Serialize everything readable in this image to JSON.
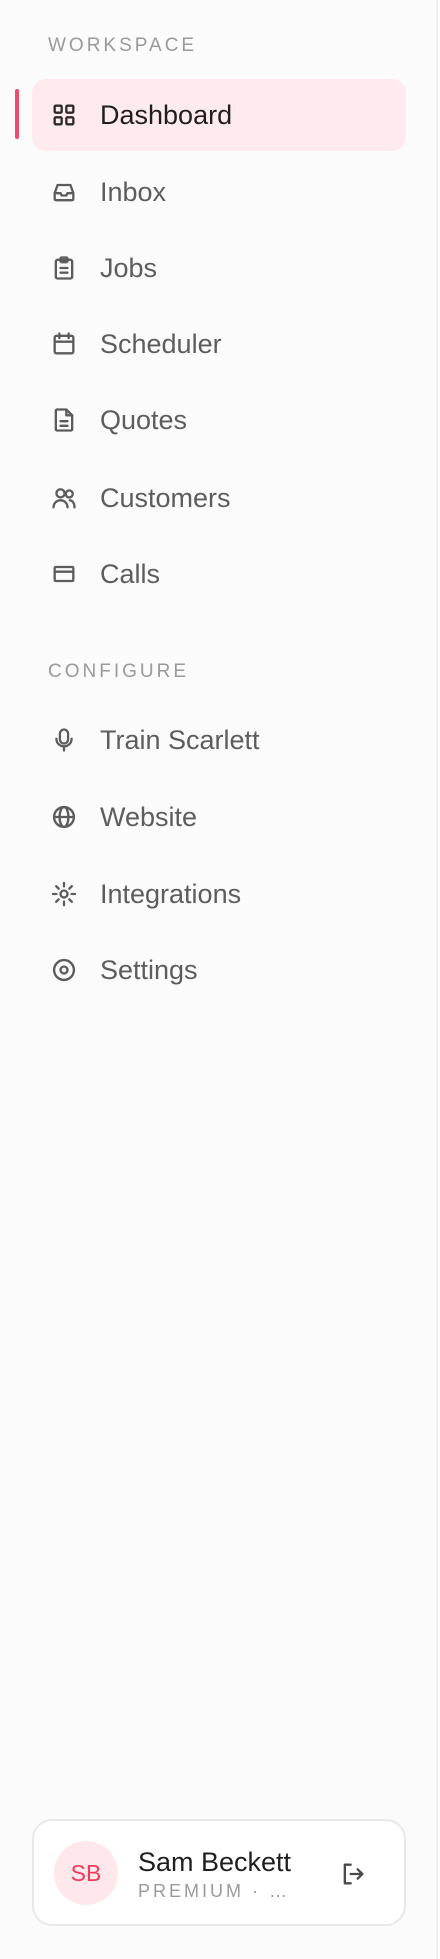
{
  "colors": {
    "accent": "#ec4d6a",
    "active_bg": "#ffeaed",
    "text": "#5d5d5d",
    "section_label": "#9a9a9a"
  },
  "sidebar": {
    "workspace_label": "WORKSPACE",
    "configure_label": "CONFIGURE",
    "workspace_items": [
      {
        "label": "Dashboard",
        "icon": "grid-icon",
        "active": true
      },
      {
        "label": "Inbox",
        "icon": "inbox-icon"
      },
      {
        "label": "Jobs",
        "icon": "clipboard-icon"
      },
      {
        "label": "Scheduler",
        "icon": "calendar-icon"
      },
      {
        "label": "Quotes",
        "icon": "document-icon"
      },
      {
        "label": "Customers",
        "icon": "users-icon"
      },
      {
        "label": "Calls",
        "icon": "card-icon"
      }
    ],
    "configure_items": [
      {
        "label": "Train Scarlett",
        "icon": "microphone-icon"
      },
      {
        "label": "Website",
        "icon": "globe-icon"
      },
      {
        "label": "Integrations",
        "icon": "sun-icon"
      },
      {
        "label": "Settings",
        "icon": "target-icon"
      }
    ]
  },
  "user": {
    "initials": "SB",
    "name": "Sam Beckett",
    "plan": "PREMIUM · S..."
  }
}
